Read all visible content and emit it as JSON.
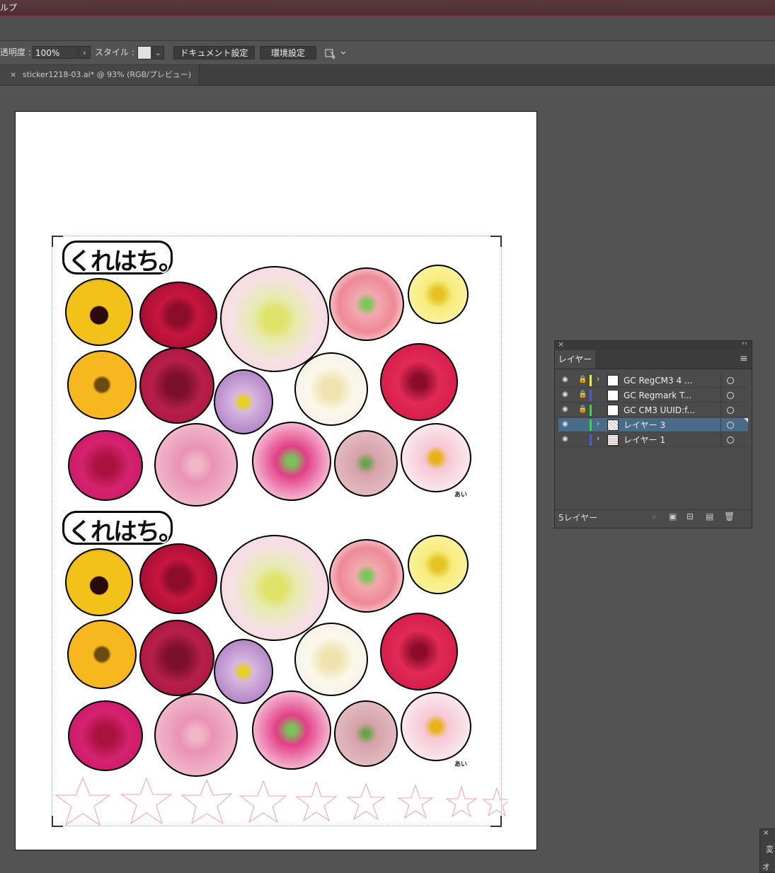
{
  "menubar": {
    "visible_text": "ルプ"
  },
  "control_bar": {
    "opacity_label": "透明度 :",
    "opacity_value": "100%",
    "style_label": "スタイル :",
    "document_setup_button": "ドキュメント設定",
    "preferences_button": "環境設定"
  },
  "document_tab": {
    "close_glyph": "×",
    "title": "sticker1218-03.ai* @ 93% (RGB/プレビュー)"
  },
  "artwork": {
    "title_text": "くれはち。",
    "signature": "あい",
    "colors": {
      "sticker_outline": "#000000",
      "star_outline": "#f0a0a0"
    }
  },
  "layers_panel": {
    "tab_label": "レイヤー",
    "footer_count": "5レイヤー",
    "layers": [
      {
        "name": "GC RegCM3 4 ...",
        "color": "#f5e642",
        "locked": true,
        "has_children": true
      },
      {
        "name": "GC Regmark T...",
        "color": "#4b5bd6",
        "locked": true,
        "has_children": false
      },
      {
        "name": "GC CM3 UUID:f...",
        "color": "#3ad34a",
        "locked": true,
        "has_children": false
      },
      {
        "name": "レイヤー 3",
        "color": "#3ad34a",
        "locked": false,
        "has_children": true,
        "selected": true
      },
      {
        "name": "レイヤー 1",
        "color": "#4b5bd6",
        "locked": false,
        "has_children": true
      }
    ]
  },
  "corner_panel": {
    "label_top": "変",
    "label_bottom": "オ"
  }
}
